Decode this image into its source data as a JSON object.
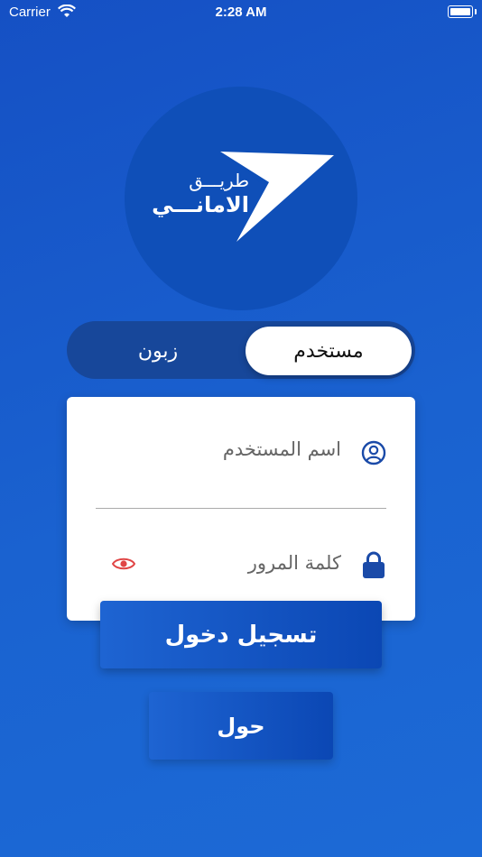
{
  "status_bar": {
    "carrier": "Carrier",
    "time": "2:28 AM"
  },
  "logo": {
    "line1": "طريـــق",
    "line2": "الامانـــي",
    "icon": "paper-plane-arrow-icon"
  },
  "tabs": {
    "active": "مستخدم",
    "inactive": "زبون"
  },
  "form": {
    "username_placeholder": "اسم المستخدم",
    "password_placeholder": "كلمة المرور",
    "username_icon": "user-circle-icon",
    "password_icon": "lock-icon",
    "visibility_icon": "eye-icon"
  },
  "buttons": {
    "login": "تسجيل دخول",
    "about": "حول"
  },
  "colors": {
    "primary": "#1550c4",
    "accent_icon": "#1a4aa8",
    "eye_icon": "#e04545",
    "toggle_track": "#17479a"
  }
}
